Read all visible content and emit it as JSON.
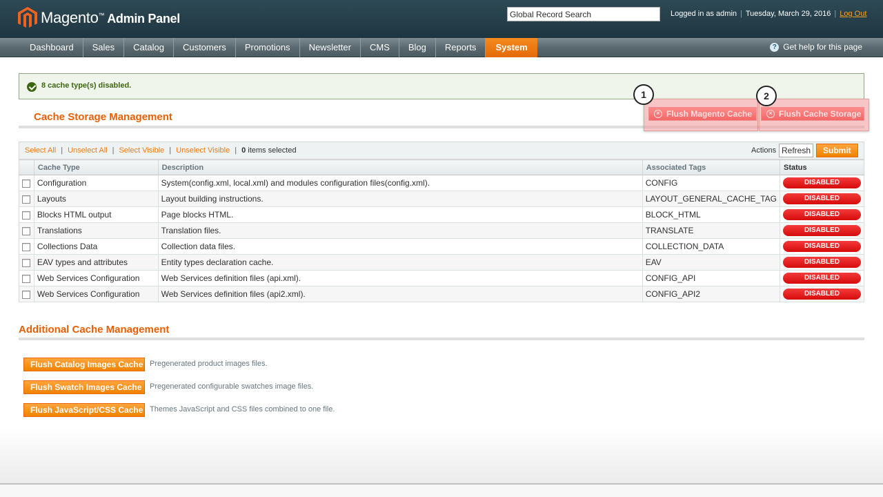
{
  "header": {
    "logo_brand": "Magento",
    "logo_tm": "™",
    "logo_sub": "Admin Panel",
    "search_value": "Global Record Search",
    "logged_in": "Logged in as admin",
    "date": "Tuesday, March 29, 2016",
    "logout": "Log Out",
    "separator": "|"
  },
  "nav": {
    "items": [
      "Dashboard",
      "Sales",
      "Catalog",
      "Customers",
      "Promotions",
      "Newsletter",
      "CMS",
      "Blog",
      "Reports",
      "System"
    ],
    "active": "System",
    "help": "Get help for this page",
    "help_icon_glyph": "?"
  },
  "message": {
    "text": "8 cache type(s) disabled."
  },
  "page": {
    "title": "Cache Storage Management",
    "flush_magento": "Flush Magento Cache",
    "flush_storage": "Flush Cache Storage",
    "callout_1": "1",
    "callout_2": "2",
    "x_glyph": "×"
  },
  "massaction": {
    "select_all": "Select All",
    "unselect_all": "Unselect All",
    "select_visible": "Select Visible",
    "unselect_visible": "Unselect Visible",
    "separator": "|",
    "selected_count": "0",
    "selected_text": " items selected",
    "actions_label": "Actions",
    "actions_value": "Refresh",
    "submit": "Submit"
  },
  "grid": {
    "columns": [
      "Cache Type",
      "Description",
      "Associated Tags",
      "Status"
    ],
    "rows": [
      {
        "type": "Configuration",
        "description": "System(config.xml, local.xml) and modules configuration files(config.xml).",
        "tags": "CONFIG",
        "status": "DISABLED"
      },
      {
        "type": "Layouts",
        "description": "Layout building instructions.",
        "tags": "LAYOUT_GENERAL_CACHE_TAG",
        "status": "DISABLED"
      },
      {
        "type": "Blocks HTML output",
        "description": "Page blocks HTML.",
        "tags": "BLOCK_HTML",
        "status": "DISABLED"
      },
      {
        "type": "Translations",
        "description": "Translation files.",
        "tags": "TRANSLATE",
        "status": "DISABLED"
      },
      {
        "type": "Collections Data",
        "description": "Collection data files.",
        "tags": "COLLECTION_DATA",
        "status": "DISABLED"
      },
      {
        "type": "EAV types and attributes",
        "description": "Entity types declaration cache.",
        "tags": "EAV",
        "status": "DISABLED"
      },
      {
        "type": "Web Services Configuration",
        "description": "Web Services definition files (api.xml).",
        "tags": "CONFIG_API",
        "status": "DISABLED"
      },
      {
        "type": "Web Services Configuration",
        "description": "Web Services definition files (api2.xml).",
        "tags": "CONFIG_API2",
        "status": "DISABLED"
      }
    ]
  },
  "additional": {
    "title": "Additional Cache Management",
    "items": [
      {
        "button": "Flush Catalog Images Cache",
        "description": "Pregenerated product images files."
      },
      {
        "button": "Flush Swatch Images Cache",
        "description": "Pregenerated configurable swatches image files."
      },
      {
        "button": "Flush JavaScript/CSS Cache",
        "description": "Themes JavaScript and CSS files combined to one file."
      }
    ]
  },
  "colors": {
    "accent_orange": "#eb5e00",
    "nav_active": "#e46a07",
    "status_disabled": "#d60a0a",
    "success_text": "#3d6611"
  }
}
